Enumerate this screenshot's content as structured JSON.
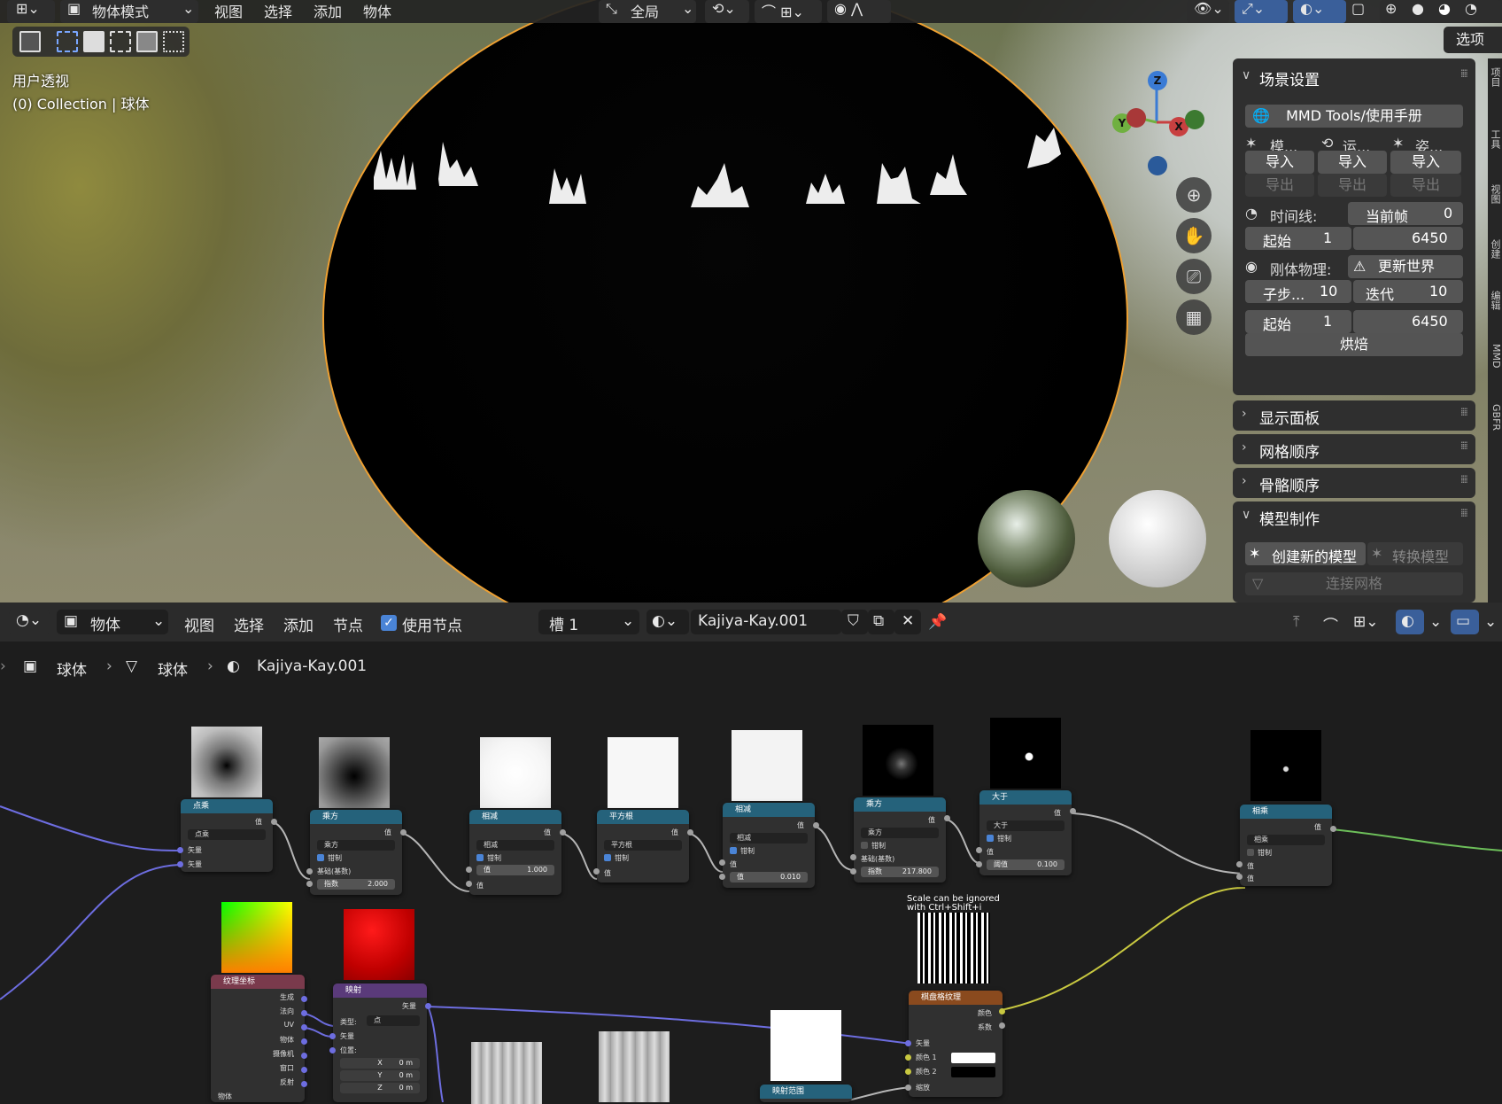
{
  "viewport": {
    "header": {
      "mode": "物体模式",
      "menu": [
        "视图",
        "选择",
        "添加",
        "物体"
      ],
      "transform": "全局"
    },
    "overlay": {
      "view_name": "用户透视",
      "collection": "(0) Collection | 球体"
    },
    "gizmo": {
      "z": "Z",
      "y": "Y",
      "x": "X"
    },
    "options_label": "选项",
    "side_tabs": [
      "项目",
      "工具",
      "视图",
      "创建",
      "编辑",
      "MMD",
      "GBFR"
    ],
    "colors": {
      "selection_outline": "#f0a030",
      "panel_bg": "#2f2f2f"
    }
  },
  "npanel": {
    "scene": {
      "title": "场景设置",
      "manual_button": "MMD Tools/使用手册",
      "cols": [
        {
          "label": "模...",
          "import": "导入",
          "export": "导出"
        },
        {
          "label": "运...",
          "import": "导入",
          "export": "导出"
        },
        {
          "label": "姿...",
          "import": "导入",
          "export": "导出"
        }
      ],
      "timeline": {
        "label": "时间线:",
        "current_label": "当前帧",
        "current": "0",
        "start_label": "起始",
        "start": "1",
        "end": "6450"
      },
      "rigid": {
        "label": "刚体物理:",
        "update": "更新世界",
        "substep_label": "子步...",
        "substep": "10",
        "iter_label": "迭代",
        "iter": "10",
        "start_label": "起始",
        "start": "1",
        "end": "6450",
        "bake": "烘焙"
      }
    },
    "display_panel": "显示面板",
    "mesh_order": "网格顺序",
    "bone_order": "骨骼顺序",
    "model": {
      "title": "模型制作",
      "create": "创建新的模型",
      "convert": "转换模型",
      "join": "连接网格"
    }
  },
  "node_editor": {
    "header": {
      "type": "物体",
      "menu": [
        "视图",
        "选择",
        "添加",
        "节点"
      ],
      "use_nodes": "使用节点",
      "slot": "槽 1",
      "material": "Kajiya-Kay.001"
    },
    "breadcrumb": [
      "球体",
      "球体",
      "Kajiya-Kay.001"
    ],
    "hint": [
      "Scale can be ignored",
      "with Ctrl+Shift+i"
    ],
    "nodes": {
      "dot": {
        "title": "点乘",
        "out": "值",
        "mode": "点乘",
        "in1": "矢量",
        "in2": "矢量"
      },
      "pow1": {
        "title": "乘方",
        "out": "值",
        "mode": "乘方",
        "clamp": "钳制",
        "base": "基础(基数)",
        "exp_label": "指数",
        "exp": "2.000"
      },
      "sub1": {
        "title": "相减",
        "out": "值",
        "mode": "相减",
        "clamp": "钳制",
        "v_label": "值",
        "v": "1.000",
        "in": "值"
      },
      "sqrt": {
        "title": "平方根",
        "out": "值",
        "mode": "平方根",
        "clamp": "钳制",
        "in": "值"
      },
      "sub2": {
        "title": "相减",
        "out": "值",
        "mode": "相减",
        "clamp": "钳制",
        "in": "值",
        "v_label": "值",
        "v": "0.010"
      },
      "pow2": {
        "title": "乘方",
        "out": "值",
        "mode": "乘方",
        "clamp": "钳制",
        "base": "基础(基数)",
        "exp_label": "指数",
        "exp": "217.800"
      },
      "gt": {
        "title": "大于",
        "out": "值",
        "mode": "大于",
        "clamp": "钳制",
        "in": "值",
        "th_label": "阈值",
        "th": "0.100"
      },
      "mul": {
        "title": "相乘",
        "out": "值",
        "mode": "相乘",
        "clamp": "钳制",
        "in1": "值",
        "in2": "值"
      },
      "texcoord": {
        "title": "纹理坐标",
        "outs": [
          "生成",
          "法向",
          "UV",
          "物体",
          "摄像机",
          "窗口",
          "反射"
        ],
        "obj": "物体"
      },
      "mapping": {
        "title": "映射",
        "out": "矢量",
        "type_label": "类型:",
        "type": "点",
        "vec": "矢量",
        "loc": "位置:",
        "x": "X",
        "y": "Y",
        "z": "Z",
        "val": "0 m"
      },
      "checker": {
        "title": "棋盘格纹理",
        "out_color": "颜色",
        "out_fac": "系数",
        "vec": "矢量",
        "c1": "颜色 1",
        "c2": "颜色 2",
        "scale": "缩放"
      },
      "maprange": {
        "title": "映射范围"
      }
    }
  }
}
